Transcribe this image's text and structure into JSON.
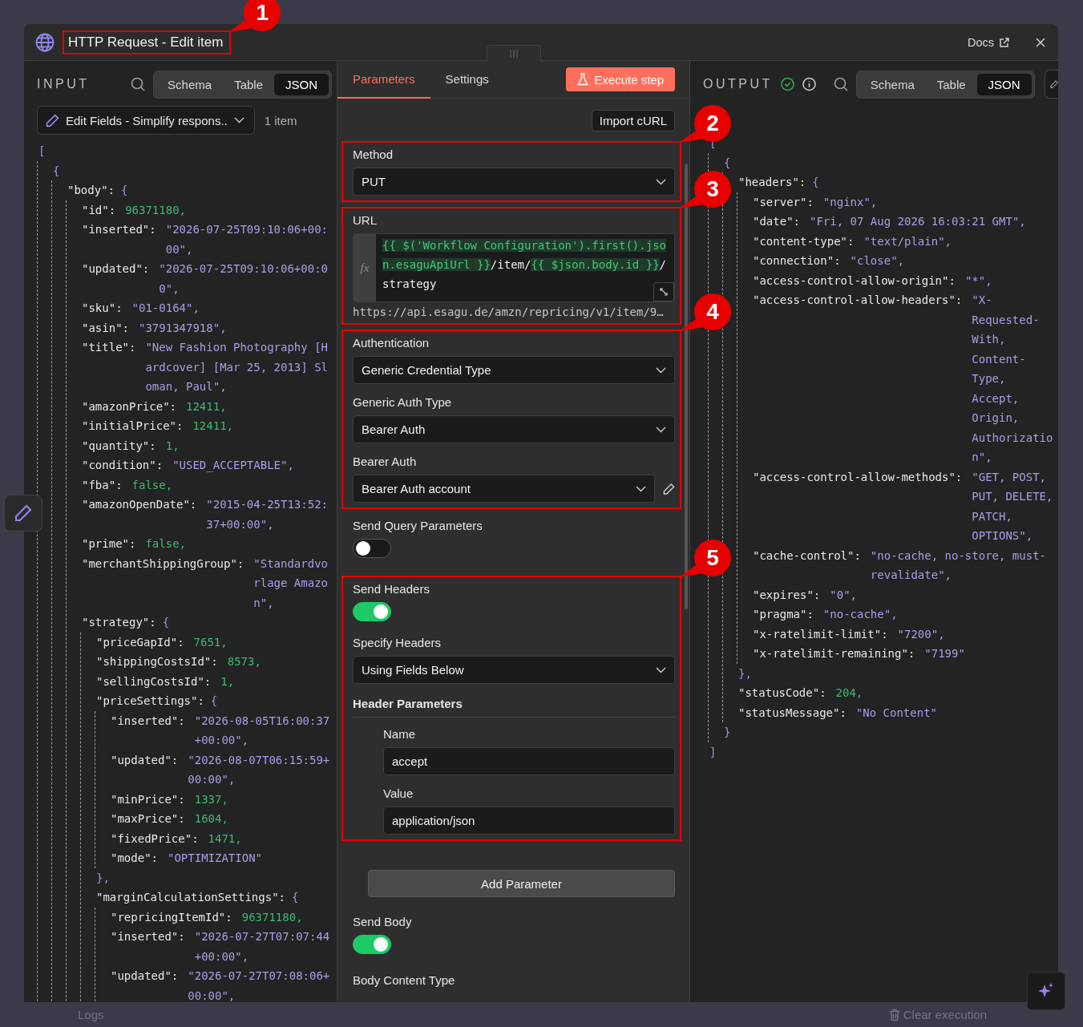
{
  "window": {
    "title": "HTTP Request - Edit item",
    "annotation": "1",
    "docs_link": "Docs"
  },
  "input_panel": {
    "heading": "INPUT",
    "view_tabs": [
      {
        "label": "Schema",
        "selected": false
      },
      {
        "label": "Table",
        "selected": false
      },
      {
        "label": "JSON",
        "selected": true
      }
    ],
    "source_node": "Edit Fields - Simplify respons..",
    "item_count": "1 item",
    "json": {
      "open": "[",
      "children": [
        {
          "open": "{",
          "children": [
            {
              "key": "\"body\":",
              "open": "{",
              "children": [
                {
                  "key": "\"id\":",
                  "value": "96371180,",
                  "kind": "number"
                },
                {
                  "key": "\"inserted\":",
                  "value": "\"2026-07-25T09:10:06+00:00\",",
                  "kind": "string"
                },
                {
                  "key": "\"updated\":",
                  "value": "\"2026-07-25T09:10:06+00:00\",",
                  "kind": "string"
                },
                {
                  "key": "\"sku\":",
                  "value": "\"01-0164\",",
                  "kind": "string"
                },
                {
                  "key": "\"asin\":",
                  "value": "\"3791347918\",",
                  "kind": "string"
                },
                {
                  "key": "\"title\":",
                  "value": "\"New Fashion Photography [Hardcover] [Mar 25, 2013] Sloman, Paul\",",
                  "kind": "string"
                },
                {
                  "key": "\"amazonPrice\":",
                  "value": "12411,",
                  "kind": "number"
                },
                {
                  "key": "\"initialPrice\":",
                  "value": "12411,",
                  "kind": "number"
                },
                {
                  "key": "\"quantity\":",
                  "value": "1,",
                  "kind": "number"
                },
                {
                  "key": "\"condition\":",
                  "value": "\"USED_ACCEPTABLE\",",
                  "kind": "string"
                },
                {
                  "key": "\"fba\":",
                  "value": "false,",
                  "kind": "boolean"
                },
                {
                  "key": "\"amazonOpenDate\":",
                  "value": "\"2015-04-25T13:52:37+00:00\",",
                  "kind": "string"
                },
                {
                  "key": "\"prime\":",
                  "value": "false,",
                  "kind": "boolean"
                },
                {
                  "key": "\"merchantShippingGroup\":",
                  "value": "\"Standardvorlage Amazon\",",
                  "kind": "string"
                },
                {
                  "key": "\"strategy\":",
                  "open": "{",
                  "children": [
                    {
                      "key": "\"priceGapId\":",
                      "value": "7651,",
                      "kind": "number"
                    },
                    {
                      "key": "\"shippingCostsId\":",
                      "value": "8573,",
                      "kind": "number"
                    },
                    {
                      "key": "\"sellingCostsId\":",
                      "value": "1,",
                      "kind": "number"
                    },
                    {
                      "key": "\"priceSettings\":",
                      "open": "{",
                      "close": "},",
                      "children": [
                        {
                          "key": "\"inserted\":",
                          "value": "\"2026-08-05T16:00:37+00:00\",",
                          "kind": "string"
                        },
                        {
                          "key": "\"updated\":",
                          "value": "\"2026-08-07T06:15:59+00:00\",",
                          "kind": "string"
                        },
                        {
                          "key": "\"minPrice\":",
                          "value": "1337,",
                          "kind": "number"
                        },
                        {
                          "key": "\"maxPrice\":",
                          "value": "1604,",
                          "kind": "number"
                        },
                        {
                          "key": "\"fixedPrice\":",
                          "value": "1471,",
                          "kind": "number"
                        },
                        {
                          "key": "\"mode\":",
                          "value": "\"OPTIMIZATION\"",
                          "kind": "string"
                        }
                      ]
                    },
                    {
                      "key": "\"marginCalculationSettings\":",
                      "open": "{",
                      "children": [
                        {
                          "key": "\"repricingItemId\":",
                          "value": "96371180,",
                          "kind": "number"
                        },
                        {
                          "key": "\"inserted\":",
                          "value": "\"2026-07-27T07:07:44+00:00\",",
                          "kind": "string"
                        },
                        {
                          "key": "\"updated\":",
                          "value": "\"2026-07-27T07:08:06+00:00\",",
                          "kind": "string"
                        }
                      ]
                    }
                  ]
                }
              ]
            }
          ]
        }
      ]
    }
  },
  "parameters_panel": {
    "tabs": [
      {
        "label": "Parameters",
        "selected": true
      },
      {
        "label": "Settings",
        "selected": false
      }
    ],
    "execute_button": "Execute step",
    "import_button": "Import cURL",
    "sections": [
      {
        "kind": "selects",
        "annotation": "2",
        "fields": [
          {
            "label": "Method",
            "value": "PUT",
            "editable": false
          }
        ]
      },
      {
        "kind": "url",
        "annotation": "3",
        "label": "URL",
        "gutter_label": "fx",
        "segments": [
          {
            "text": "{{ $('Workflow Configuration').first().json.esaguApiUrl }}",
            "expression": true
          },
          {
            "text": "/item/",
            "expression": false
          },
          {
            "text": "{{ $json.body.id }}",
            "expression": true
          },
          {
            "text": "/strategy",
            "expression": false
          }
        ],
        "preview": "https://api.esagu.de/amzn/repricing/v1/item/9…"
      },
      {
        "kind": "selects",
        "annotation": "4",
        "fields": [
          {
            "label": "Authentication",
            "value": "Generic Credential Type",
            "editable": false
          },
          {
            "label": "Generic Auth Type",
            "value": "Bearer Auth",
            "editable": false
          },
          {
            "label": "Bearer Auth",
            "value": "Bearer Auth account",
            "editable": true
          }
        ]
      },
      {
        "kind": "toggle",
        "label": "Send Query Parameters",
        "on": false
      },
      {
        "kind": "headers",
        "annotation": "5",
        "toggle": {
          "label": "Send Headers",
          "on": true
        },
        "specify": {
          "label": "Specify Headers",
          "value": "Using Fields Below"
        },
        "group_label": "Header Parameters",
        "name": {
          "label": "Name",
          "value": "accept"
        },
        "value": {
          "label": "Value",
          "value": "application/json"
        }
      },
      {
        "kind": "button",
        "label": "Add Parameter"
      },
      {
        "kind": "toggle",
        "label": "Send Body",
        "on": true
      },
      {
        "kind": "label",
        "label": "Body Content Type"
      }
    ]
  },
  "output_panel": {
    "heading": "OUTPUT",
    "view_tabs": [
      {
        "label": "Schema",
        "selected": false
      },
      {
        "label": "Table",
        "selected": false
      },
      {
        "label": "JSON",
        "selected": true
      }
    ],
    "json": {
      "open": "[",
      "close": "]",
      "children": [
        {
          "open": "{",
          "close": "}",
          "children": [
            {
              "key": "\"headers\":",
              "open": "{",
              "close": "},",
              "children": [
                {
                  "key": "\"server\":",
                  "value": "\"nginx\",",
                  "kind": "string"
                },
                {
                  "key": "\"date\":",
                  "value": "\"Fri, 07 Aug 2026 16:03:21 GMT\",",
                  "kind": "string"
                },
                {
                  "key": "\"content-type\":",
                  "value": "\"text/plain\",",
                  "kind": "string"
                },
                {
                  "key": "\"connection\":",
                  "value": "\"close\",",
                  "kind": "string"
                },
                {
                  "key": "\"access-control-allow-origin\":",
                  "value": "\"*\",",
                  "kind": "string"
                },
                {
                  "key": "\"access-control-allow-headers\":",
                  "value": "\"X-Requested-With, Content-Type, Accept, Origin, Authorization\",",
                  "kind": "string"
                },
                {
                  "key": "\"access-control-allow-methods\":",
                  "value": "\"GET, POST, PUT, DELETE, PATCH, OPTIONS\",",
                  "kind": "string"
                },
                {
                  "key": "\"cache-control\":",
                  "value": "\"no-cache, no-store, must-revalidate\",",
                  "kind": "string"
                },
                {
                  "key": "\"expires\":",
                  "value": "\"0\",",
                  "kind": "string"
                },
                {
                  "key": "\"pragma\":",
                  "value": "\"no-cache\",",
                  "kind": "string"
                },
                {
                  "key": "\"x-ratelimit-limit\":",
                  "value": "\"7200\",",
                  "kind": "string"
                },
                {
                  "key": "\"x-ratelimit-remaining\":",
                  "value": "\"7199\"",
                  "kind": "string"
                }
              ]
            },
            {
              "key": "\"statusCode\":",
              "value": "204,",
              "kind": "number"
            },
            {
              "key": "\"statusMessage\":",
              "value": "\"No Content\"",
              "kind": "string"
            }
          ]
        }
      ]
    }
  },
  "status_bar": {
    "logs": "Logs",
    "clear_button": "Clear execution"
  }
}
